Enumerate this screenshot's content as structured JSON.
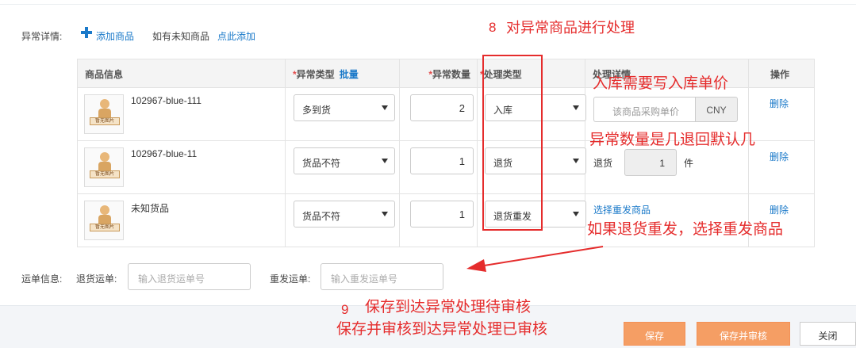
{
  "exception": {
    "label": "异常详情:",
    "add_product": "添加商品",
    "unknown_hint": "如有未知商品",
    "click_add": "点此添加"
  },
  "table": {
    "headers": {
      "product_info": "商品信息",
      "exception_type": "异常类型",
      "batch": "批量",
      "exception_qty": "异常数量",
      "handling_type": "处理类型",
      "handling_detail": "处理详情",
      "action": "操作"
    },
    "rows": [
      {
        "sku": "102967-blue-111",
        "image_text": "暂无图片",
        "exception_type": "多到货",
        "qty": "2",
        "handling": "入库",
        "price_placeholder": "该商品采购单价",
        "currency": "CNY",
        "delete": "删除"
      },
      {
        "sku": "102967-blue-11",
        "image_text": "暂无图片",
        "exception_type": "货品不符",
        "qty": "1",
        "handling": "退货",
        "return_label": "退货",
        "return_qty": "1",
        "unit": "件",
        "delete": "删除"
      },
      {
        "sku": "未知货品",
        "image_text": "暂无图片",
        "exception_type": "货品不符",
        "qty": "1",
        "handling": "退货重发",
        "select_resend": "选择重发商品",
        "delete": "删除"
      }
    ]
  },
  "shipping": {
    "label": "运单信息:",
    "return_label": "退货运单:",
    "return_placeholder": "输入退货运单号",
    "resend_label": "重发运单:",
    "resend_placeholder": "输入重发运单号"
  },
  "buttons": {
    "save": "保存",
    "save_approve": "保存并审核",
    "close": "关闭"
  },
  "annotations": {
    "a8_num": "8",
    "a8_text": "对异常商品进行处理",
    "inbound": "入库需要写入库单价",
    "qty_note": "异常数量是几退回默认几",
    "resend_note": "如果退货重发，选择重发商品",
    "a9_num": "9",
    "a9_line1": "保存到达异常处理待审核",
    "a9_line2": "保存并审核到达异常处理已审核"
  },
  "colors": {
    "accent": "#1a79c9",
    "annotation_red": "#e52c2c",
    "button_orange": "#f59e64"
  }
}
